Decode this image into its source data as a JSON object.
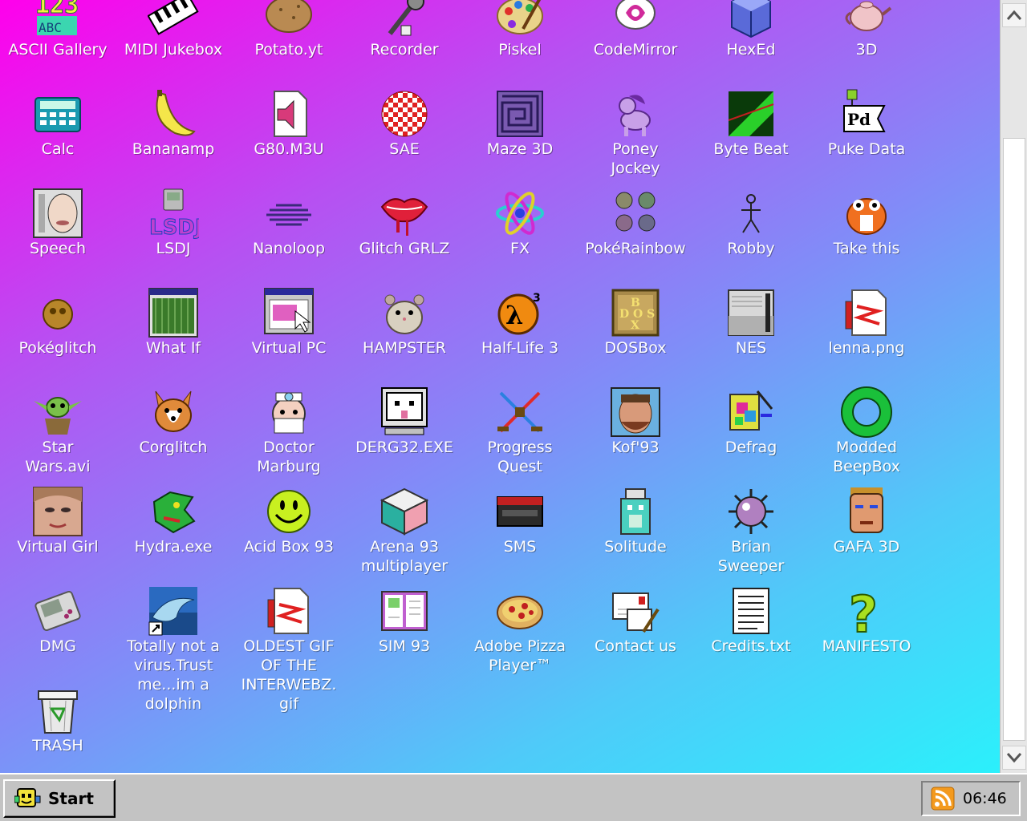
{
  "desktop": {
    "icons": [
      {
        "label": "ASCII Gallery",
        "icon": "ascii-gallery-icon"
      },
      {
        "label": "MIDI Jukebox",
        "icon": "midi-jukebox-icon"
      },
      {
        "label": "Potato.yt",
        "icon": "potato-icon"
      },
      {
        "label": "Recorder",
        "icon": "microphone-icon"
      },
      {
        "label": "Piskel",
        "icon": "paint-palette-icon"
      },
      {
        "label": "CodeMirror",
        "icon": "codemirror-icon"
      },
      {
        "label": "HexEd",
        "icon": "hex-cube-icon"
      },
      {
        "label": "3D",
        "icon": "teapot-icon"
      },
      {
        "label": "Calc",
        "icon": "calculator-icon"
      },
      {
        "label": "Bananamp",
        "icon": "banana-icon"
      },
      {
        "label": "G80.M3U",
        "icon": "audio-file-icon"
      },
      {
        "label": "SAE",
        "icon": "amiga-ball-icon"
      },
      {
        "label": "Maze 3D",
        "icon": "maze-icon"
      },
      {
        "label": "Poney\nJockey",
        "icon": "pony-icon"
      },
      {
        "label": "Byte Beat",
        "icon": "byte-beat-icon"
      },
      {
        "label": "Puke Data",
        "icon": "pd-icon"
      },
      {
        "label": "Speech",
        "icon": "speech-face-icon"
      },
      {
        "label": "LSDJ",
        "icon": "lsdj-icon"
      },
      {
        "label": "Nanoloop",
        "icon": "nanoloop-icon"
      },
      {
        "label": "Glitch GRLZ",
        "icon": "lips-icon"
      },
      {
        "label": "FX",
        "icon": "atom-icon"
      },
      {
        "label": "PokéRainbow",
        "icon": "pokerainbow-icon"
      },
      {
        "label": "Robby",
        "icon": "stick-figure-icon"
      },
      {
        "label": "Take this",
        "icon": "orange-creature-icon"
      },
      {
        "label": "Pokéglitch",
        "icon": "pokeglitch-icon"
      },
      {
        "label": "What If",
        "icon": "green-window-icon"
      },
      {
        "label": "Virtual PC",
        "icon": "virtual-pc-icon"
      },
      {
        "label": "HAMPSTER",
        "icon": "hamster-icon"
      },
      {
        "label": "Half-Life 3",
        "icon": "half-life-icon"
      },
      {
        "label": "DOSBox",
        "icon": "dosbox-icon"
      },
      {
        "label": "NES",
        "icon": "nes-console-icon"
      },
      {
        "label": "lenna.png",
        "icon": "image-file-icon"
      },
      {
        "label": "Star\nWars.avi",
        "icon": "yoda-icon"
      },
      {
        "label": "Corglitch",
        "icon": "corgi-icon"
      },
      {
        "label": "Doctor\nMarburg",
        "icon": "doctor-icon"
      },
      {
        "label": "DERG32.EXE",
        "icon": "derg-computer-icon"
      },
      {
        "label": "Progress\nQuest",
        "icon": "crossed-swords-icon"
      },
      {
        "label": "Kof'93",
        "icon": "fighter-face-icon"
      },
      {
        "label": "Defrag",
        "icon": "defrag-icon"
      },
      {
        "label": "Modded\nBeepBox",
        "icon": "green-ring-icon"
      },
      {
        "label": "Virtual Girl",
        "icon": "virtual-girl-icon"
      },
      {
        "label": "Hydra.exe",
        "icon": "hydra-dragon-icon"
      },
      {
        "label": "Acid Box 93",
        "icon": "smiley-icon"
      },
      {
        "label": "Arena 93\nmultiplayer",
        "icon": "cube-icon"
      },
      {
        "label": "SMS",
        "icon": "sms-console-icon"
      },
      {
        "label": "Solitude",
        "icon": "solitude-icon"
      },
      {
        "label": "Brian\nSweeper",
        "icon": "mine-icon"
      },
      {
        "label": "GAFA 3D",
        "icon": "wolfenstein-face-icon"
      },
      {
        "label": "DMG",
        "icon": "gameboy-icon"
      },
      {
        "label": "Totally not a\nvirus.Trust\nme...im a\ndolphin",
        "icon": "dolphin-icon"
      },
      {
        "label": "OLDEST GIF\nOF THE\nINTERWEBZ.\ngif",
        "icon": "gif-file-icon"
      },
      {
        "label": "SIM 93",
        "icon": "book-icon"
      },
      {
        "label": "Adobe Pizza\nPlayer™",
        "icon": "pizza-icon"
      },
      {
        "label": "Contact us",
        "icon": "letter-icon"
      },
      {
        "label": "Credits.txt",
        "icon": "text-file-icon"
      },
      {
        "label": "MANIFESTO",
        "icon": "question-mark-icon"
      },
      {
        "label": "TRASH",
        "icon": "trash-icon"
      }
    ]
  },
  "taskbar": {
    "start_label": "Start",
    "start_icon": "start-logo-icon",
    "tray_icon": "rss-icon",
    "clock": "06:46"
  },
  "scrollbar": {
    "up_icon": "chevron-up-icon",
    "down_icon": "chevron-down-icon"
  }
}
